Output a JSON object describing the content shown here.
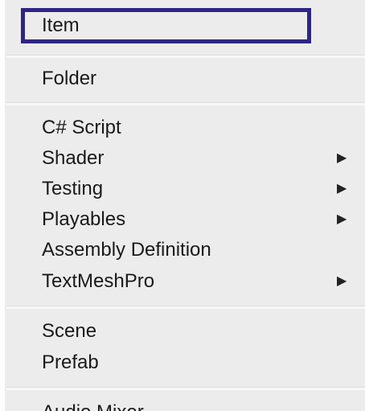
{
  "menu": {
    "group1": [
      {
        "label": "Item"
      }
    ],
    "group2": [
      {
        "label": "Folder"
      }
    ],
    "group3": [
      {
        "label": "C# Script"
      },
      {
        "label": "Shader",
        "submenu": true
      },
      {
        "label": "Testing",
        "submenu": true
      },
      {
        "label": "Playables",
        "submenu": true
      },
      {
        "label": "Assembly Definition"
      },
      {
        "label": "TextMeshPro",
        "submenu": true
      }
    ],
    "group4": [
      {
        "label": "Scene"
      },
      {
        "label": "Prefab"
      }
    ],
    "group5": [
      {
        "label": "Audio Mixer"
      }
    ],
    "submenu_arrow": "▶"
  },
  "colors": {
    "menu_background": "#ececec",
    "highlight_border": "#2e2584",
    "text": "#1a1a1a"
  }
}
